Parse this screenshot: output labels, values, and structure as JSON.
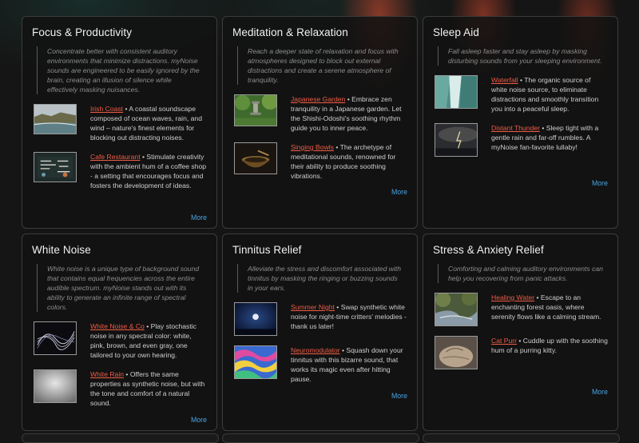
{
  "colors": {
    "link": "#ee5c46",
    "more": "#47a3e0",
    "card_bg": "#121212",
    "card_border": "#3c3c3c"
  },
  "more_label": "More",
  "categories": [
    {
      "title": "Focus & Productivity",
      "description": "Concentrate better with consistent auditory environments that minimize distractions. myNoise sounds are engineered to be easily ignored by the brain, creating an illusion of silence while effectively masking nuisances.",
      "items": [
        {
          "name": "Irish Coast",
          "text": " • A coastal soundscape composed of ocean waves, rain, and wind – nature's finest elements for blocking out distracting noises.",
          "icon": "irish-coast-thumbnail"
        },
        {
          "name": "Cafe Restaurant",
          "text": " • Stimulate creativity with the ambient hum of a coffee shop - a setting that encourages focus and fosters the development of ideas.",
          "icon": "cafe-restaurant-thumbnail"
        }
      ]
    },
    {
      "title": "Meditation & Relaxation",
      "description": "Reach a deeper state of relaxation and focus with atmospheres designed to block out external distractions and create a serene atmosphere of tranquility.",
      "items": [
        {
          "name": "Japanese Garden",
          "text": " • Embrace zen tranquility in a Japanese garden. Let the Shishi-Odoshi's soothing rhythm guide you to inner peace.",
          "icon": "japanese-garden-thumbnail"
        },
        {
          "name": "Singing Bowls",
          "text": " • The archetype of meditational sounds, renowned for their ability to produce soothing vibrations.",
          "icon": "singing-bowls-thumbnail"
        }
      ]
    },
    {
      "title": "Sleep Aid",
      "description": "Fall asleep faster and stay asleep by masking disturbing sounds from your sleeping environment.",
      "items": [
        {
          "name": "Waterfall",
          "text": " • The organic source of white noise source, to eliminate distractions and smoothly transition you into a peaceful sleep.",
          "icon": "waterfall-thumbnail"
        },
        {
          "name": "Distant Thunder",
          "text": " • Sleep tight with a gentle rain and far-off rumbles. A myNoise fan-favorite lullaby!",
          "icon": "distant-thunder-thumbnail"
        }
      ]
    },
    {
      "title": "White Noise",
      "description": "White noise is a unique type of background sound that contains equal frequencies across the entire audible spectrum. myNoise stands out with its ability to generate an infinite range of spectral colors.",
      "items": [
        {
          "name": "White Noise & Co",
          "text": " • Play stochastic noise in any spectral color: white, pink, brown, and even gray, one tailored to your own hearing.",
          "icon": "white-noise-thumbnail"
        },
        {
          "name": "White Rain",
          "text": " • Offers the same properties as synthetic noise, but with the tone and comfort of a natural sound.",
          "icon": "white-rain-thumbnail"
        }
      ]
    },
    {
      "title": "Tinnitus Relief",
      "description": "Alleviate the stress and discomfort associated with tinnitus by masking the ringing or buzzing sounds in your ears.",
      "items": [
        {
          "name": "Summer Night",
          "text": " • Swap synthetic white noise for night-time critters' melodies - thank us later!",
          "icon": "summer-night-thumbnail"
        },
        {
          "name": "Neuromodulator",
          "text": " • Squash down your tinnitus with this bizarre sound, that works its magic even after hitting pause.",
          "icon": "neuromodulator-thumbnail"
        }
      ]
    },
    {
      "title": "Stress & Anxiety Relief",
      "description": "Comforting and calming auditory environments can help you recovering from panic attacks.",
      "items": [
        {
          "name": "Healing Water",
          "text": " • Escape to an enchanting forest oasis, where serenity flows like a calming stream.",
          "icon": "healing-water-thumbnail"
        },
        {
          "name": "Cat Purr",
          "text": " • Cuddle up with the soothing hum of a purring kitty.",
          "icon": "cat-purr-thumbnail"
        }
      ]
    }
  ]
}
